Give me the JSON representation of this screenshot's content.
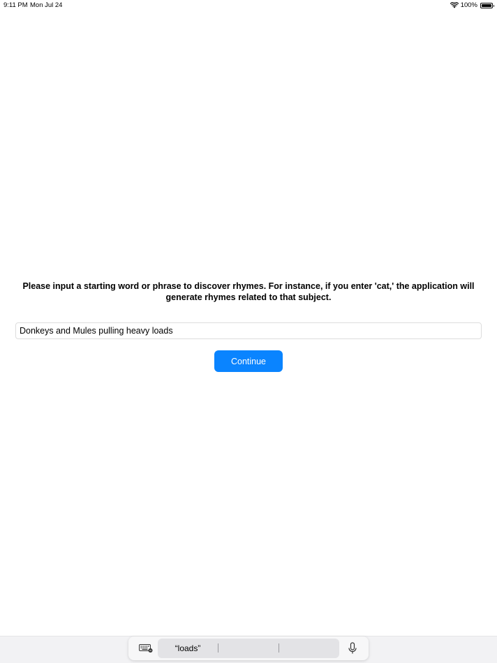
{
  "status_bar": {
    "time": "9:11 PM",
    "date": "Mon Jul 24",
    "battery": "100%",
    "icons": [
      "wifi-icon",
      "battery-icon"
    ]
  },
  "prompt": {
    "text": "Please input a starting word or phrase to discover rhymes. For instance, if you enter 'cat,' the application will generate rhymes related to that subject."
  },
  "input": {
    "value": "Donkeys and Mules pulling heavy loads",
    "placeholder": ""
  },
  "actions": {
    "continue_label": "Continue"
  },
  "keyboard_bar": {
    "suggestions": [
      "“loads”",
      "",
      ""
    ],
    "icons": [
      "keyboard-icon",
      "microphone-icon"
    ]
  },
  "colors": {
    "accent": "#0a84ff",
    "background": "#ffffff",
    "field_border": "#dddddd",
    "keyboard_bar_bg": "#f2f2f4"
  }
}
